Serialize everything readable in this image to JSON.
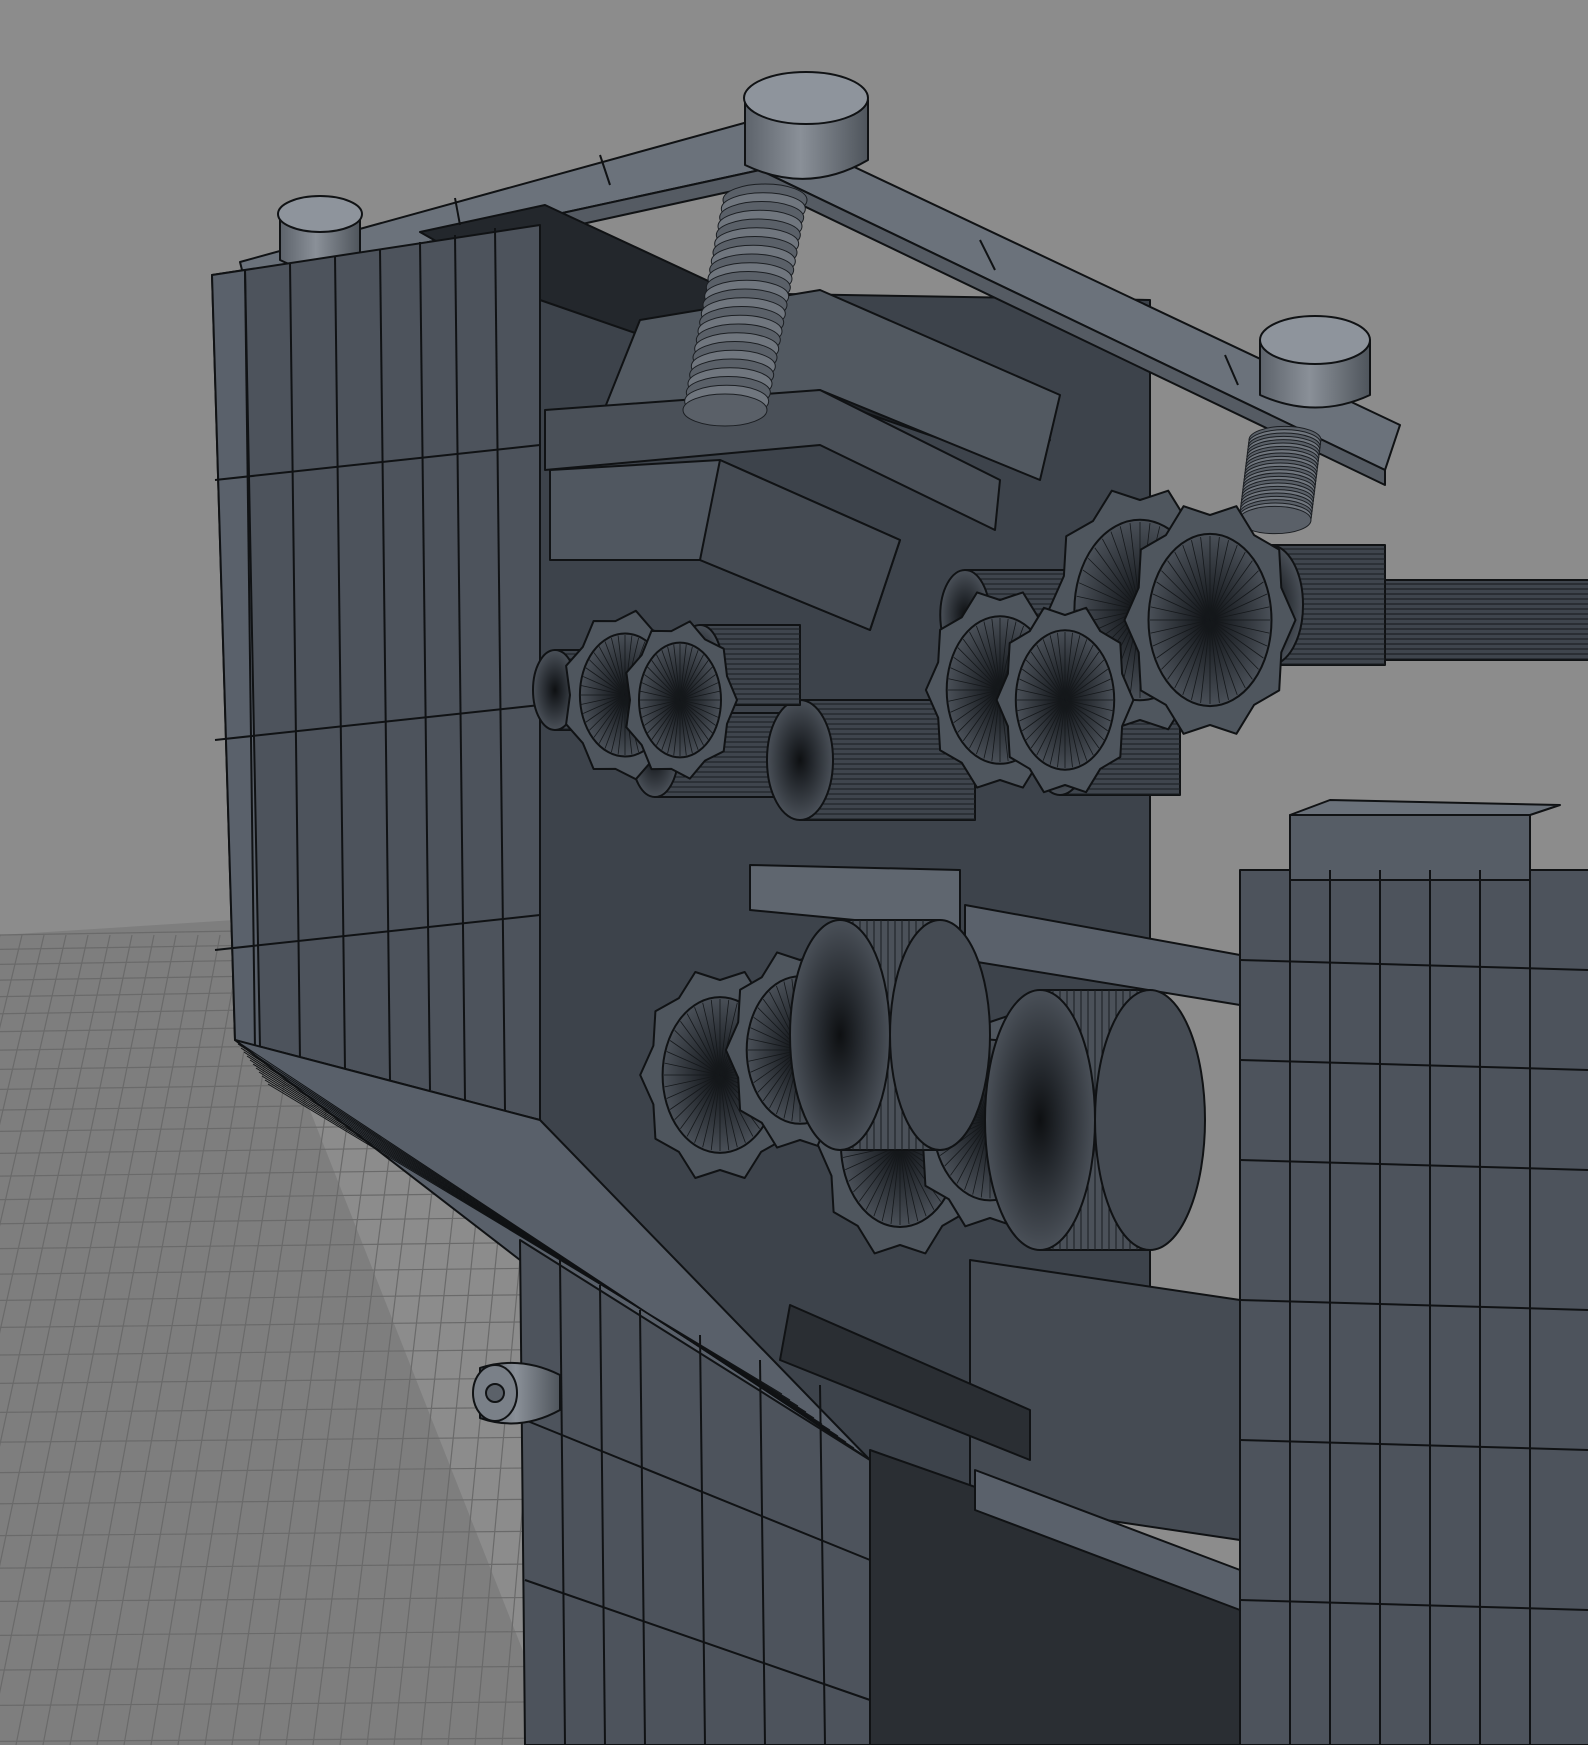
{
  "viewport": {
    "background_color": "#8c8c8c",
    "grid_floor_color": "#7e7e7e",
    "grid_line_color": "#6a6a6a",
    "model_face_color": "#4d535c",
    "model_face_light_color": "#5a616b",
    "model_face_dark_color": "#2a2e33",
    "wire_color": "#101214",
    "shaft_color": "#3f454d",
    "knob_color": "#6e747c",
    "icons": [
      "grid-floor",
      "wireframe-mesh",
      "gear-icon",
      "screw-icon",
      "knob-icon"
    ]
  }
}
